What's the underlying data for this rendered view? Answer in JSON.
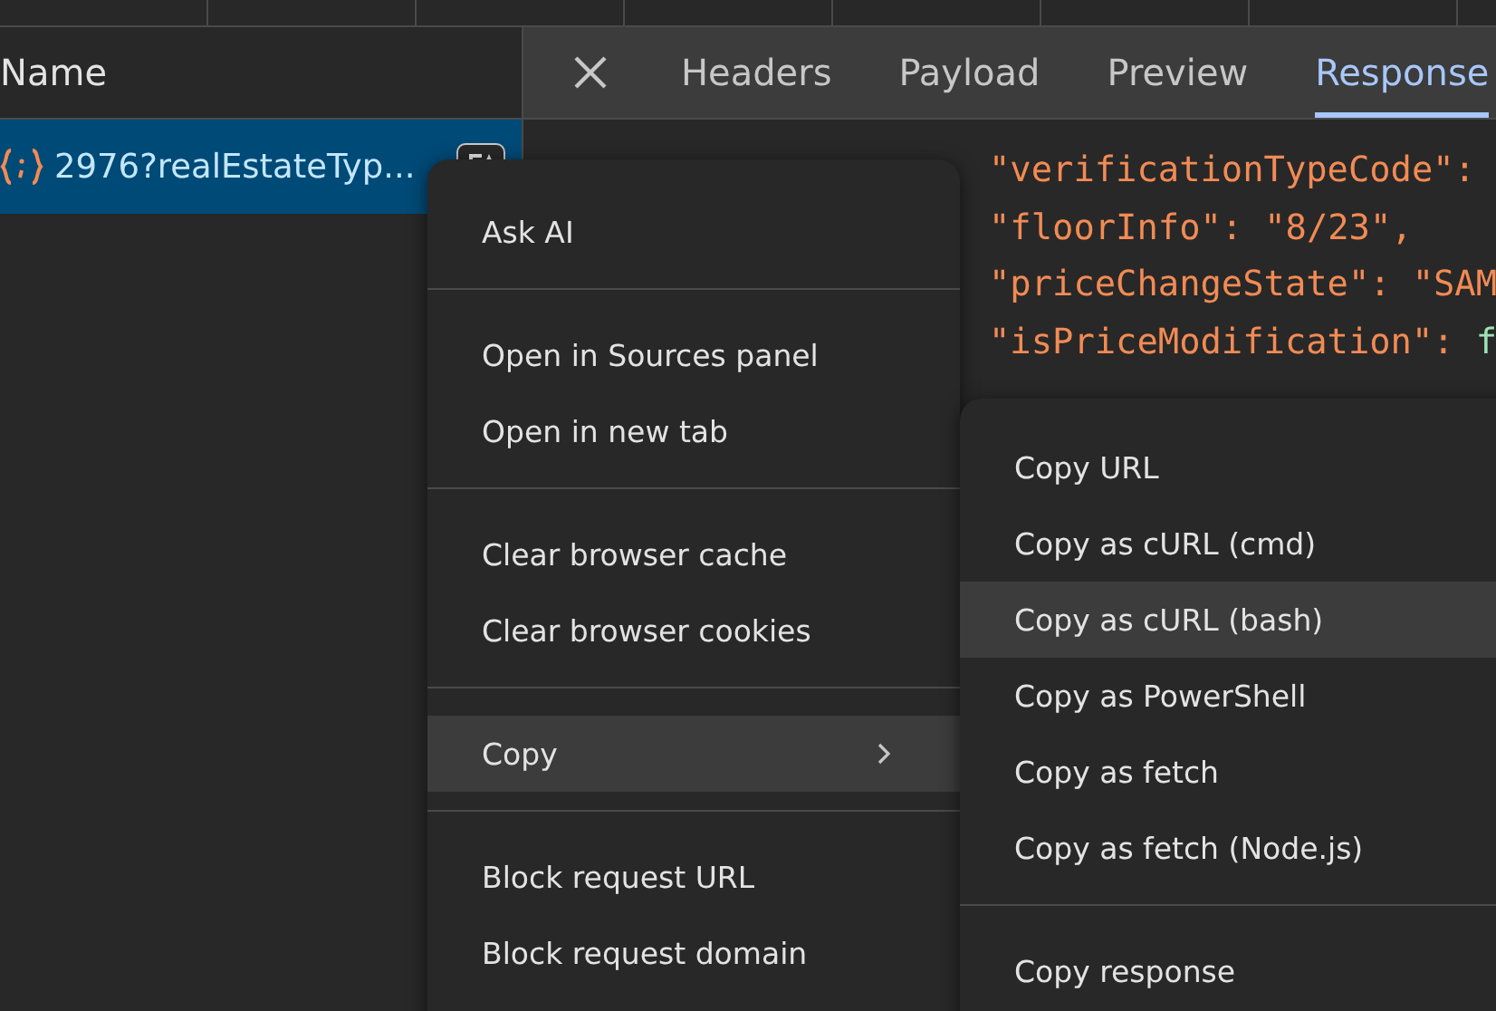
{
  "requests": {
    "column": "Name",
    "rows": [
      {
        "name": "2976?realEstateTyp...",
        "selected": true
      }
    ]
  },
  "detail_tabs": [
    {
      "label": "Headers",
      "selected": false
    },
    {
      "label": "Payload",
      "selected": false
    },
    {
      "label": "Preview",
      "selected": false
    },
    {
      "label": "Response",
      "selected": true
    }
  ],
  "response_lines": [
    {
      "key": "\"verificationTypeCode\":"
    },
    {
      "key": "\"floorInfo\":",
      "value": "\"8/23\",",
      "kind": "string"
    },
    {
      "key": "\"priceChangeState\":",
      "value": "\"SAM",
      "kind": "string"
    },
    {
      "key": "\"isPriceModification\":",
      "value": "f",
      "kind": "boolean"
    }
  ],
  "context_menu": {
    "groups": [
      [
        {
          "label": "Ask AI",
          "highlighted": false,
          "submenu": false
        }
      ],
      [
        {
          "label": "Open in Sources panel",
          "highlighted": false,
          "submenu": false
        },
        {
          "label": "Open in new tab",
          "highlighted": false,
          "submenu": false
        }
      ],
      [
        {
          "label": "Clear browser cache",
          "highlighted": false,
          "submenu": false
        },
        {
          "label": "Clear browser cookies",
          "highlighted": false,
          "submenu": false
        }
      ],
      [
        {
          "label": "Copy",
          "highlighted": true,
          "submenu": true
        }
      ],
      [
        {
          "label": "Block request URL",
          "highlighted": false,
          "submenu": false
        },
        {
          "label": "Block request domain",
          "highlighted": false,
          "submenu": false
        }
      ]
    ]
  },
  "copy_submenu": {
    "groups": [
      [
        {
          "label": "Copy URL",
          "highlighted": false
        },
        {
          "label": "Copy as cURL (cmd)",
          "highlighted": false
        },
        {
          "label": "Copy as cURL (bash)",
          "highlighted": true
        },
        {
          "label": "Copy as PowerShell",
          "highlighted": false
        },
        {
          "label": "Copy as fetch",
          "highlighted": false
        },
        {
          "label": "Copy as fetch (Node.js)",
          "highlighted": false
        }
      ],
      [
        {
          "label": "Copy response",
          "highlighted": false
        }
      ]
    ]
  }
}
